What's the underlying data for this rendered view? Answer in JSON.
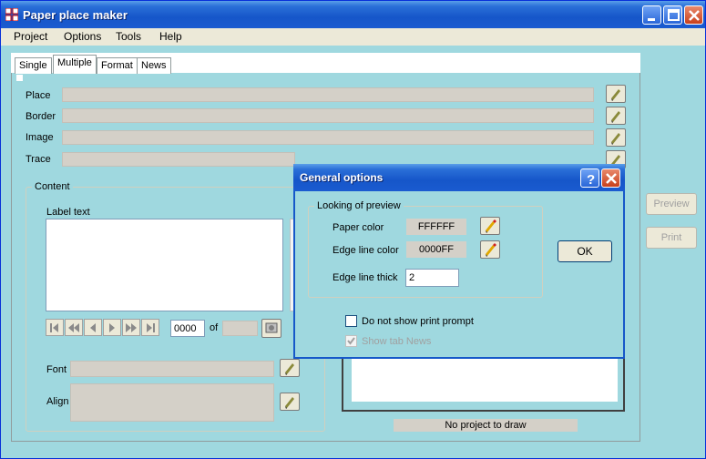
{
  "window": {
    "title": "Paper place maker"
  },
  "menu": [
    "Project",
    "Options",
    "Tools",
    "Help"
  ],
  "tabs": [
    {
      "label": "Single"
    },
    {
      "label": "Multiple"
    },
    {
      "label": "Format"
    },
    {
      "label": "News"
    }
  ],
  "active_tab": "Multiple",
  "fields": {
    "place": "Place",
    "border": "Border",
    "image": "Image",
    "trace": "Trace"
  },
  "content_group": {
    "legend": "Content",
    "label_text": "Label text",
    "record_index": "0000",
    "of_label": "of",
    "font_label": "Font",
    "align_label": "Align"
  },
  "side_buttons": {
    "preview": "Preview",
    "print": "Print"
  },
  "status": "No project to draw",
  "dialog": {
    "title": "General options",
    "group_legend": "Looking of preview",
    "paper_color_label": "Paper color",
    "paper_color_value": "FFFFFF",
    "edge_color_label": "Edge line color",
    "edge_color_value": "0000FF",
    "edge_thick_label": "Edge line thick",
    "edge_thick_value": "2",
    "ok_label": "OK",
    "no_print_prompt_label": "Do not show print prompt",
    "no_print_prompt_checked": false,
    "show_news_label": "Show tab News",
    "show_news_checked": true
  },
  "colors": {
    "background": "#9fd8df",
    "titlebar": "#1a5bd0"
  }
}
